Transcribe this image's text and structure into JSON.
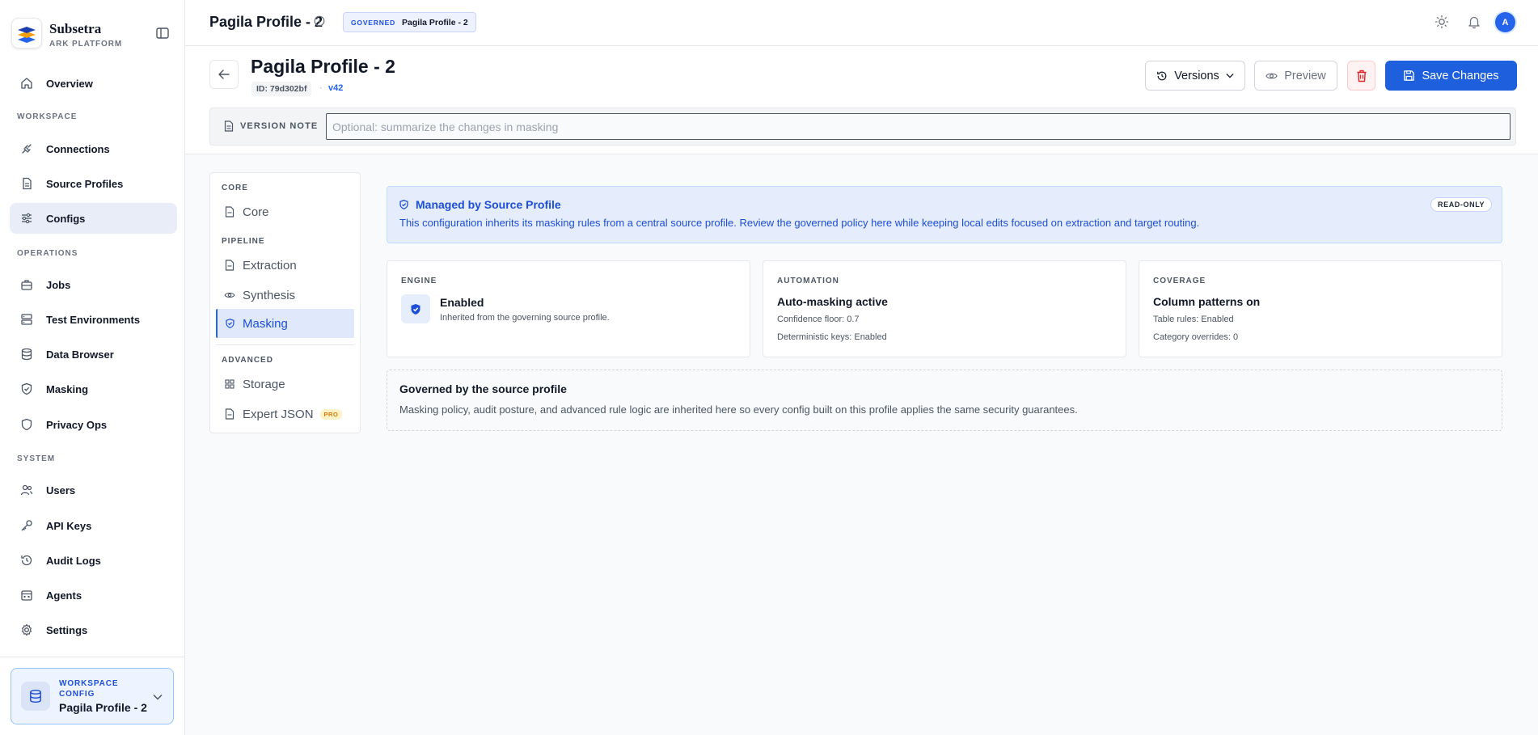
{
  "brand": {
    "name": "Subsetra",
    "sub": "ARK PLATFORM"
  },
  "sidebar": {
    "overview": "Overview",
    "sections": {
      "workspace": "WORKSPACE",
      "operations": "OPERATIONS",
      "system": "SYSTEM"
    },
    "workspace_items": [
      "Connections",
      "Source Profiles",
      "Configs"
    ],
    "operations_items": [
      "Jobs",
      "Test Environments",
      "Data Browser",
      "Masking",
      "Privacy Ops"
    ],
    "system_items": [
      "Users",
      "API Keys",
      "Audit Logs",
      "Agents",
      "Settings"
    ],
    "active_item": "Configs",
    "footer": {
      "label": "WORKSPACE CONFIG",
      "value": "Pagila Profile - 2"
    }
  },
  "topbar": {
    "title": "Pagila Profile - 2",
    "badge_tag": "GOVERNED",
    "badge_value": "Pagila Profile - 2",
    "avatar_initial": "A"
  },
  "header": {
    "title": "Pagila Profile - 2",
    "id_label": "ID: 79d302bf",
    "separator": "·",
    "version": "v42",
    "versions_label": "Versions",
    "preview_label": "Preview",
    "save_label": "Save Changes",
    "version_note_label": "VERSION NOTE",
    "version_note_placeholder": "Optional: summarize the changes in masking",
    "version_note_value": ""
  },
  "section_nav": {
    "groups": {
      "core": "CORE",
      "pipeline": "PIPELINE",
      "advanced": "ADVANCED"
    },
    "items": {
      "core": "Core",
      "extraction": "Extraction",
      "synthesis": "Synthesis",
      "masking": "Masking",
      "storage": "Storage",
      "expert_json": "Expert JSON"
    },
    "pro_tag": "PRO",
    "active": "Masking"
  },
  "banner": {
    "title": "Managed by Source Profile",
    "text": "This configuration inherits its masking rules from a central source profile. Review the governed policy here while keeping local edits focused on extraction and target routing.",
    "badge": "READ-ONLY"
  },
  "cards": {
    "engine": {
      "label": "ENGINE",
      "title": "Enabled",
      "sub": "Inherited from the governing source profile."
    },
    "automation": {
      "label": "AUTOMATION",
      "title": "Auto-masking active",
      "line1": "Confidence floor: 0.7",
      "line2": "Deterministic keys: Enabled"
    },
    "coverage": {
      "label": "COVERAGE",
      "title": "Column patterns on",
      "line1": "Table rules: Enabled",
      "line2": "Category overrides: 0"
    }
  },
  "governed": {
    "title": "Governed by the source profile",
    "text": "Masking policy, audit posture, and advanced rule logic are inherited here so every config built on this profile applies the same security guarantees."
  },
  "colors": {
    "accent": "#1d5fdc",
    "active_bg": "#e8edf8",
    "banner_bg": "#e5ecfb"
  }
}
